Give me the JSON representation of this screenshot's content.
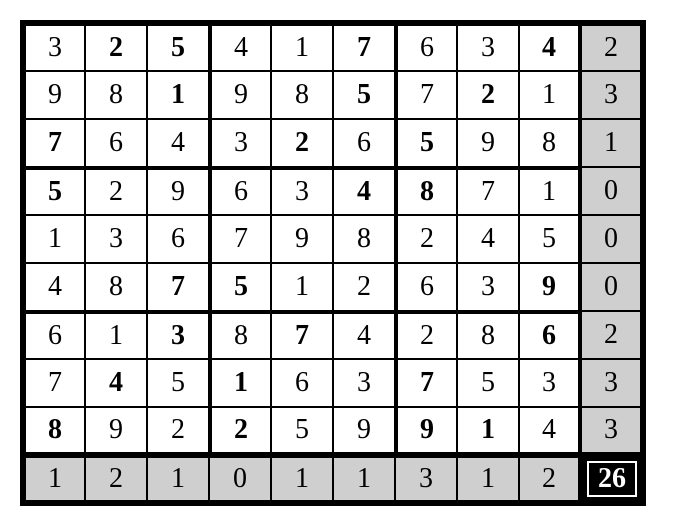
{
  "grid": {
    "rows": [
      {
        "cells": [
          {
            "v": "3"
          },
          {
            "v": "2",
            "b": true
          },
          {
            "v": "5",
            "b": true
          },
          {
            "v": "4"
          },
          {
            "v": "1"
          },
          {
            "v": "7",
            "b": true
          },
          {
            "v": "6"
          },
          {
            "v": "3"
          },
          {
            "v": "4",
            "b": true
          }
        ],
        "sum": "2"
      },
      {
        "cells": [
          {
            "v": "9"
          },
          {
            "v": "8"
          },
          {
            "v": "1",
            "b": true
          },
          {
            "v": "9"
          },
          {
            "v": "8"
          },
          {
            "v": "5",
            "b": true
          },
          {
            "v": "7"
          },
          {
            "v": "2",
            "b": true
          },
          {
            "v": "1"
          }
        ],
        "sum": "3"
      },
      {
        "cells": [
          {
            "v": "7",
            "b": true
          },
          {
            "v": "6"
          },
          {
            "v": "4"
          },
          {
            "v": "3"
          },
          {
            "v": "2",
            "b": true
          },
          {
            "v": "6"
          },
          {
            "v": "5",
            "b": true
          },
          {
            "v": "9"
          },
          {
            "v": "8"
          }
        ],
        "sum": "1"
      },
      {
        "cells": [
          {
            "v": "5",
            "b": true
          },
          {
            "v": "2"
          },
          {
            "v": "9"
          },
          {
            "v": "6"
          },
          {
            "v": "3"
          },
          {
            "v": "4",
            "b": true
          },
          {
            "v": "8",
            "b": true
          },
          {
            "v": "7"
          },
          {
            "v": "1"
          }
        ],
        "sum": "0"
      },
      {
        "cells": [
          {
            "v": "1"
          },
          {
            "v": "3"
          },
          {
            "v": "6"
          },
          {
            "v": "7"
          },
          {
            "v": "9"
          },
          {
            "v": "8"
          },
          {
            "v": "2"
          },
          {
            "v": "4"
          },
          {
            "v": "5"
          }
        ],
        "sum": "0"
      },
      {
        "cells": [
          {
            "v": "4"
          },
          {
            "v": "8"
          },
          {
            "v": "7",
            "b": true
          },
          {
            "v": "5",
            "b": true
          },
          {
            "v": "1"
          },
          {
            "v": "2"
          },
          {
            "v": "6"
          },
          {
            "v": "3"
          },
          {
            "v": "9",
            "b": true
          }
        ],
        "sum": "0"
      },
      {
        "cells": [
          {
            "v": "6"
          },
          {
            "v": "1"
          },
          {
            "v": "3",
            "b": true
          },
          {
            "v": "8"
          },
          {
            "v": "7",
            "b": true
          },
          {
            "v": "4"
          },
          {
            "v": "2"
          },
          {
            "v": "8"
          },
          {
            "v": "6",
            "b": true
          }
        ],
        "sum": "2"
      },
      {
        "cells": [
          {
            "v": "7"
          },
          {
            "v": "4",
            "b": true
          },
          {
            "v": "5"
          },
          {
            "v": "1",
            "b": true
          },
          {
            "v": "6"
          },
          {
            "v": "3"
          },
          {
            "v": "7",
            "b": true
          },
          {
            "v": "5"
          },
          {
            "v": "3"
          }
        ],
        "sum": "3"
      },
      {
        "cells": [
          {
            "v": "8",
            "b": true
          },
          {
            "v": "9"
          },
          {
            "v": "2"
          },
          {
            "v": "2",
            "b": true
          },
          {
            "v": "5"
          },
          {
            "v": "9"
          },
          {
            "v": "9",
            "b": true
          },
          {
            "v": "1",
            "b": true
          },
          {
            "v": "4"
          }
        ],
        "sum": "3"
      }
    ],
    "col_sums": [
      "1",
      "2",
      "1",
      "0",
      "1",
      "1",
      "3",
      "1",
      "2"
    ],
    "total": "26"
  },
  "chart_data": {
    "type": "table",
    "title": "9x9 number grid with row and column sums",
    "rows": [
      [
        3,
        2,
        5,
        4,
        1,
        7,
        6,
        3,
        4
      ],
      [
        9,
        8,
        1,
        9,
        8,
        5,
        7,
        2,
        1
      ],
      [
        7,
        6,
        4,
        3,
        2,
        6,
        5,
        9,
        8
      ],
      [
        5,
        2,
        9,
        6,
        3,
        4,
        8,
        7,
        1
      ],
      [
        1,
        3,
        6,
        7,
        9,
        8,
        2,
        4,
        5
      ],
      [
        4,
        8,
        7,
        5,
        1,
        2,
        6,
        3,
        9
      ],
      [
        6,
        1,
        3,
        8,
        7,
        4,
        2,
        8,
        6
      ],
      [
        7,
        4,
        5,
        1,
        6,
        3,
        7,
        5,
        3
      ],
      [
        8,
        9,
        2,
        2,
        5,
        9,
        9,
        1,
        4
      ]
    ],
    "bold_mask": [
      [
        0,
        1,
        1,
        0,
        0,
        1,
        0,
        0,
        1
      ],
      [
        0,
        0,
        1,
        0,
        0,
        1,
        0,
        1,
        0
      ],
      [
        1,
        0,
        0,
        0,
        1,
        0,
        1,
        0,
        0
      ],
      [
        1,
        0,
        0,
        0,
        0,
        1,
        1,
        0,
        0
      ],
      [
        0,
        0,
        0,
        0,
        0,
        0,
        0,
        0,
        0
      ],
      [
        0,
        0,
        1,
        1,
        0,
        0,
        0,
        0,
        1
      ],
      [
        0,
        0,
        1,
        0,
        1,
        0,
        0,
        0,
        1
      ],
      [
        0,
        1,
        0,
        1,
        0,
        0,
        1,
        0,
        0
      ],
      [
        1,
        0,
        0,
        1,
        0,
        0,
        1,
        1,
        0
      ]
    ],
    "row_sums": [
      2,
      3,
      1,
      0,
      0,
      0,
      2,
      3,
      3
    ],
    "col_sums": [
      1,
      2,
      1,
      0,
      1,
      1,
      3,
      1,
      2
    ],
    "total": 26
  }
}
